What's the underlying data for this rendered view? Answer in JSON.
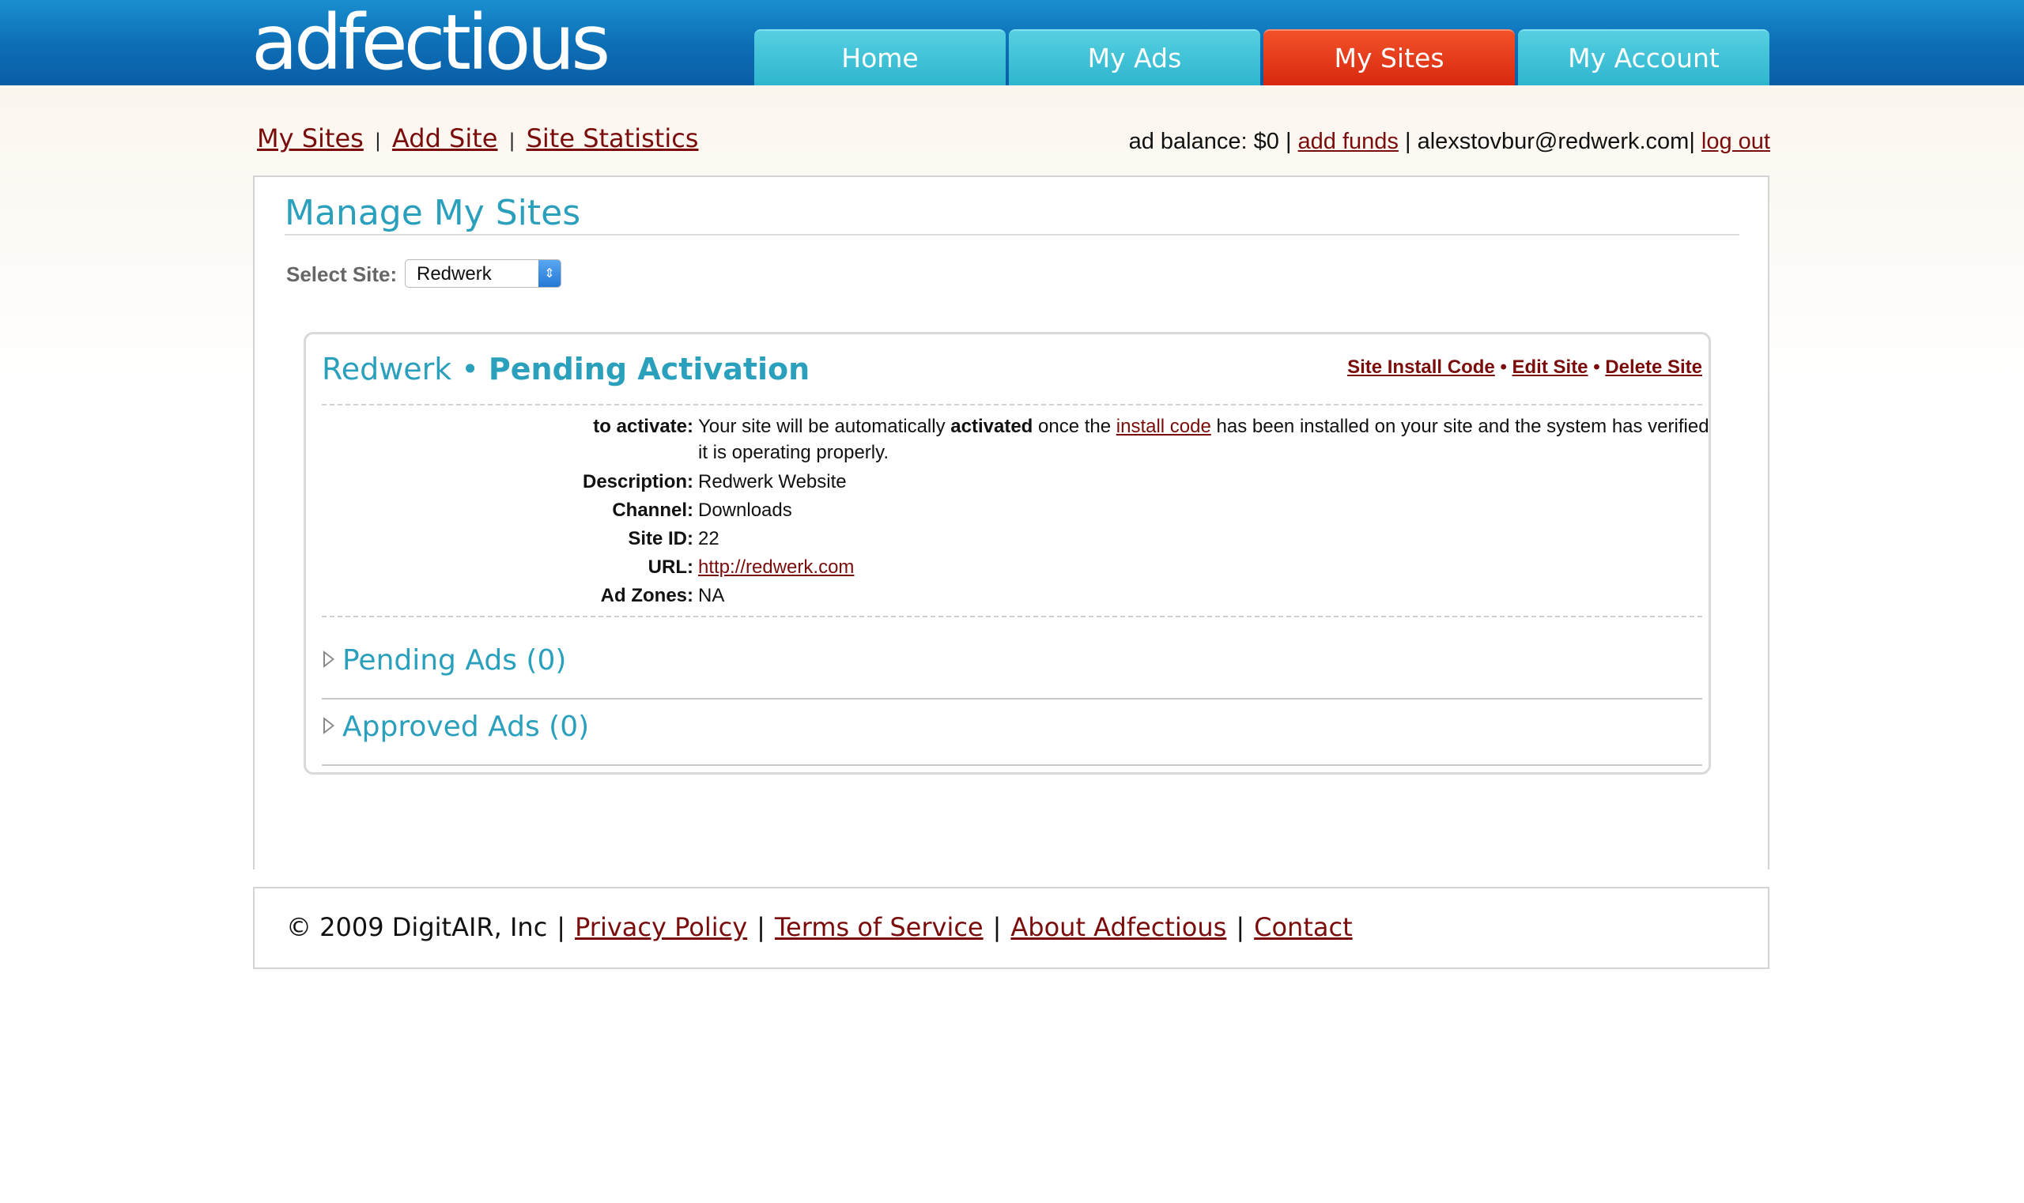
{
  "brand": {
    "logo_text": "adfectious"
  },
  "nav": {
    "tabs": [
      {
        "label": "Home",
        "active": false
      },
      {
        "label": "My Ads",
        "active": false
      },
      {
        "label": "My Sites",
        "active": true
      },
      {
        "label": "My Account",
        "active": false
      }
    ]
  },
  "subnav": {
    "my_sites": "My Sites",
    "add_site": "Add Site",
    "site_statistics": "Site Statistics",
    "separator": "|"
  },
  "account": {
    "balance_text": "ad balance: $0",
    "add_funds": "add funds",
    "email": "alexstovbur@redwerk.com",
    "logout": "log out"
  },
  "main": {
    "title": "Manage My Sites",
    "select_label": "Select Site:",
    "selected_site": "Redwerk"
  },
  "site": {
    "name": "Redwerk",
    "bullet": "•",
    "status": "Pending Activation",
    "actions": {
      "install_code": "Site Install Code",
      "edit": "Edit Site",
      "delete": "Delete Site"
    },
    "activate": {
      "label": "to activate:",
      "text_1": "Your site will be automatically",
      "text_bold": "activated",
      "text_2": "once the",
      "link": "install code",
      "text_3": "has been installed on your site and the system has verified it is operating properly."
    },
    "details": {
      "description_label": "Description:",
      "description": "Redwerk Website",
      "channel_label": "Channel:",
      "channel": "Downloads",
      "site_id_label": "Site ID:",
      "site_id": "22",
      "url_label": "URL:",
      "url": "http://redwerk.com",
      "ad_zones_label": "Ad Zones:",
      "ad_zones": "NA"
    },
    "pending_ads": "Pending Ads (0)",
    "approved_ads": "Approved Ads (0)"
  },
  "footer": {
    "copyright": "© 2009 DigitAIR, Inc",
    "links": [
      "Privacy Policy",
      "Terms of Service",
      "About Adfectious",
      "Contact"
    ],
    "separator": "|"
  },
  "colors": {
    "accent": "#2aa0bd",
    "link": "#7a0c0c",
    "header_blue": "#0c6db5",
    "tab_active": "#e33a1a",
    "tab": "#3fc1d6"
  }
}
